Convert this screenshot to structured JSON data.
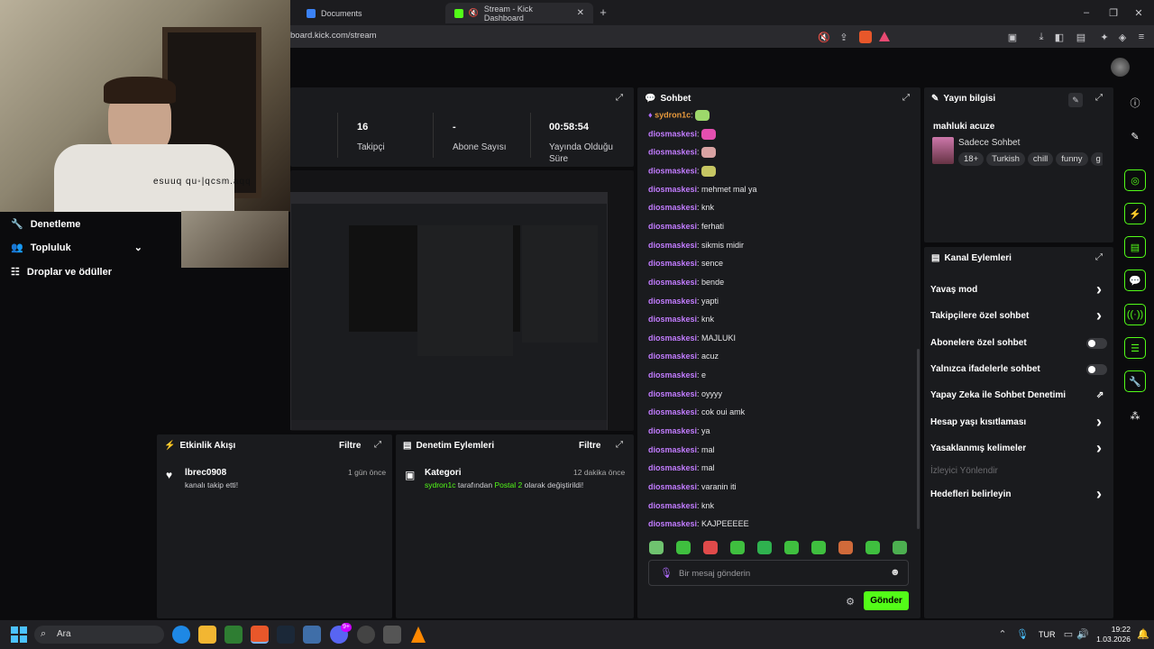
{
  "browser": {
    "tabs": [
      {
        "label": "Documents"
      },
      {
        "label": "Stream - Kick Dashboard"
      }
    ],
    "url": "board.kick.com/stream",
    "new_tab_icon": "plus-icon"
  },
  "webcam": {
    "mirrored_text": "esuuq qu◦|qcsm.aqq"
  },
  "stats": [
    {
      "value": "16",
      "label": "Takipçi"
    },
    {
      "value": "-",
      "label": "Abone Sayısı"
    },
    {
      "value": "00:58:54",
      "label": "Yayında Olduğu Süre"
    }
  ],
  "left_nav": [
    {
      "label": "Denetleme",
      "icon": "wrench-icon"
    },
    {
      "label": "Topluluk",
      "icon": "people-icon"
    },
    {
      "label": "Droplar ve ödüller",
      "icon": "gift-icon"
    }
  ],
  "activity": {
    "title": "Etkinlik Akışı",
    "filter": "Filtre",
    "items": [
      {
        "user": "lbrec0908",
        "text": "kanalı takip etti!",
        "time": "1 gün önce"
      }
    ]
  },
  "moderation": {
    "title": "Denetim Eylemleri",
    "filter": "Filtre",
    "items": [
      {
        "title": "Kategori",
        "user": "sydron1c",
        "mid": " tarafından ",
        "cat": "Postal 2",
        "end": " olarak değiştirildi!",
        "time": "12 dakika önce"
      }
    ]
  },
  "chat": {
    "title": "Sohbet",
    "messages": [
      {
        "user": "sydron1c",
        "text": "",
        "emote": "#9dd86b",
        "first": true
      },
      {
        "user": "diosmaskesi",
        "text": "",
        "emote": "#e34fb0"
      },
      {
        "user": "diosmaskesi",
        "text": "",
        "emote": "#d9a3a3"
      },
      {
        "user": "diosmaskesi",
        "text": "",
        "emote": "#c6c663"
      },
      {
        "user": "diosmaskesi",
        "text": "mehmet mal ya"
      },
      {
        "user": "diosmaskesi",
        "text": "knk"
      },
      {
        "user": "diosmaskesi",
        "text": "ferhati"
      },
      {
        "user": "diosmaskesi",
        "text": "sikmis midir"
      },
      {
        "user": "diosmaskesi",
        "text": "sence"
      },
      {
        "user": "diosmaskesi",
        "text": "bende"
      },
      {
        "user": "diosmaskesi",
        "text": "yapti"
      },
      {
        "user": "diosmaskesi",
        "text": "knk"
      },
      {
        "user": "diosmaskesi",
        "text": "MAJLUKI"
      },
      {
        "user": "diosmaskesi",
        "text": "acuz"
      },
      {
        "user": "diosmaskesi",
        "text": "e"
      },
      {
        "user": "diosmaskesi",
        "text": "oyyyy"
      },
      {
        "user": "diosmaskesi",
        "text": "cok oui amk"
      },
      {
        "user": "diosmaskesi",
        "text": "ya"
      },
      {
        "user": "diosmaskesi",
        "text": "mal"
      },
      {
        "user": "diosmaskesi",
        "text": "mal"
      },
      {
        "user": "diosmaskesi",
        "text": "varanin iti"
      },
      {
        "user": "diosmaskesi",
        "text": "knk"
      },
      {
        "user": "diosmaskesi",
        "text": "KAJPEEEEE"
      }
    ],
    "input_placeholder": "Bir mesaj gönderin",
    "send_label": "Gönder",
    "emote_colors": [
      "#6fc36f",
      "#3fbf3f",
      "#e04a4a",
      "#3fbf3f",
      "#2fb24f",
      "#3fbf3f",
      "#3fbf3f",
      "#d06a3a",
      "#3fbf3f",
      "#4caf50"
    ]
  },
  "stream_info": {
    "title": "Yayın bilgisi",
    "stream_title": "mahluki acuze",
    "category": "Sadece Sohbet",
    "tags": [
      "18+",
      "Turkish",
      "chill",
      "funny",
      "g"
    ]
  },
  "channel_actions": {
    "title": "Kanal Eylemleri",
    "items": [
      {
        "label": "Yavaş mod",
        "type": "chevron"
      },
      {
        "label": "Takipçilere özel sohbet",
        "type": "chevron"
      },
      {
        "label": "Abonelere özel sohbet",
        "type": "toggle"
      },
      {
        "label": "Yalnızca ifadelerle sohbet",
        "type": "toggle"
      },
      {
        "label": "Yapay Zeka ile Sohbet Denetimi",
        "type": "external"
      },
      {
        "label": "Hesap yaşı kısıtlaması",
        "type": "chevron"
      },
      {
        "label": "Yasaklanmış kelimeler",
        "type": "chevron"
      },
      {
        "label": "İzleyici Yönlendir",
        "type": "disabled"
      },
      {
        "label": "Hedefleri belirleyin",
        "type": "chevron"
      }
    ]
  },
  "taskbar": {
    "search_label": "Ara",
    "lang": "TUR",
    "time": "19:22",
    "date": "1.03.2026",
    "badge": "9+"
  }
}
